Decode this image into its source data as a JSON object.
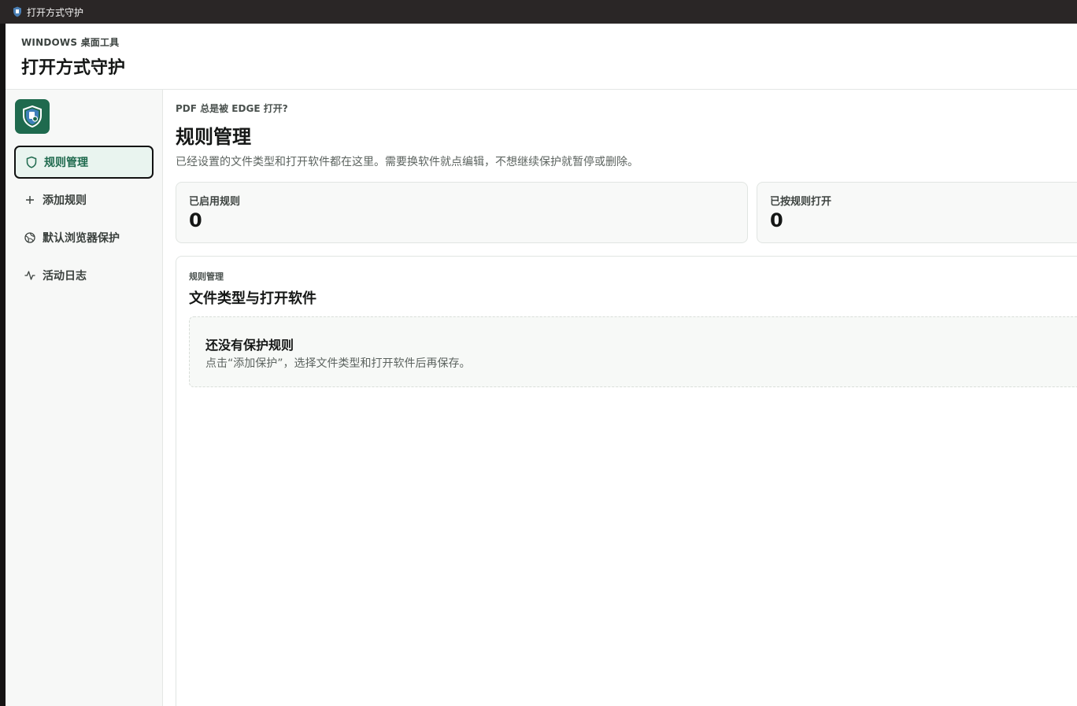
{
  "window": {
    "title": "打开方式守护"
  },
  "header": {
    "eyebrow": "WINDOWS 桌面工具",
    "title": "打开方式守护"
  },
  "sidebar": {
    "items": [
      {
        "label": "规则管理",
        "icon": "shield-icon",
        "active": true
      },
      {
        "label": "添加规则",
        "icon": "plus-icon",
        "active": false
      },
      {
        "label": "默认浏览器保护",
        "icon": "globe-icon",
        "active": false
      },
      {
        "label": "活动日志",
        "icon": "activity-icon",
        "active": false
      }
    ]
  },
  "main": {
    "eyebrow": "PDF 总是被 EDGE 打开?",
    "title": "规则管理",
    "description": "已经设置的文件类型和打开软件都在这里。需要换软件就点编辑，不想继续保护就暂停或删除。",
    "stats": [
      {
        "label": "已启用规则",
        "value": "0"
      },
      {
        "label": "已按规则打开",
        "value": "0"
      }
    ],
    "panel": {
      "eyebrow": "规则管理",
      "title": "文件类型与打开软件",
      "empty_title": "还没有保护规则",
      "empty_desc": "点击“添加保护”，选择文件类型和打开软件后再保存。"
    }
  },
  "colors": {
    "accent": "#1f6a4e",
    "active_bg": "#e9f4ef",
    "titlebar": "#2a2626"
  }
}
